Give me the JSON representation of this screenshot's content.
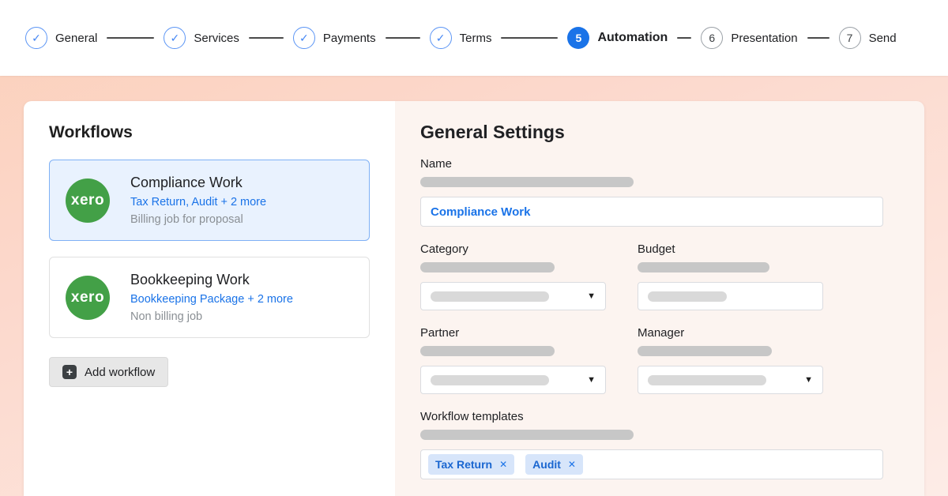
{
  "icons": {
    "check": "✓",
    "plus": "+",
    "close": "✕",
    "caret": "▼"
  },
  "colors": {
    "accent_blue": "#1a73e8",
    "active_step_blue": "#1a73e8",
    "xero_green": "#43a047",
    "chip_bg": "#d7e5fa",
    "selected_card_bg": "#e9f2fe",
    "selected_card_border": "#7fb0f5"
  },
  "stepper": {
    "steps": [
      {
        "label": "General",
        "state": "done"
      },
      {
        "label": "Services",
        "state": "done"
      },
      {
        "label": "Payments",
        "state": "done"
      },
      {
        "label": "Terms",
        "state": "done"
      },
      {
        "label": "Automation",
        "state": "active",
        "number": "5"
      },
      {
        "label": "Presentation",
        "state": "todo",
        "number": "6"
      },
      {
        "label": "Send",
        "state": "todo",
        "number": "7"
      }
    ]
  },
  "workflows": {
    "title": "Workflows",
    "items": [
      {
        "logo": "xero",
        "name": "Compliance Work",
        "services": "Tax Return, Audit + 2 more",
        "billing": "Billing job for proposal",
        "selected": true
      },
      {
        "logo": "xero",
        "name": "Bookkeeping Work",
        "services": "Bookkeeping Package + 2 more",
        "billing": "Non billing job",
        "selected": false
      }
    ],
    "add_button": "Add workflow"
  },
  "settings": {
    "title": "General Settings",
    "name_label": "Name",
    "name_value": "Compliance Work",
    "category_label": "Category",
    "budget_label": "Budget",
    "partner_label": "Partner",
    "manager_label": "Manager",
    "templates_label": "Workflow templates",
    "template_chips": [
      {
        "label": "Tax Return"
      },
      {
        "label": "Audit"
      }
    ]
  }
}
